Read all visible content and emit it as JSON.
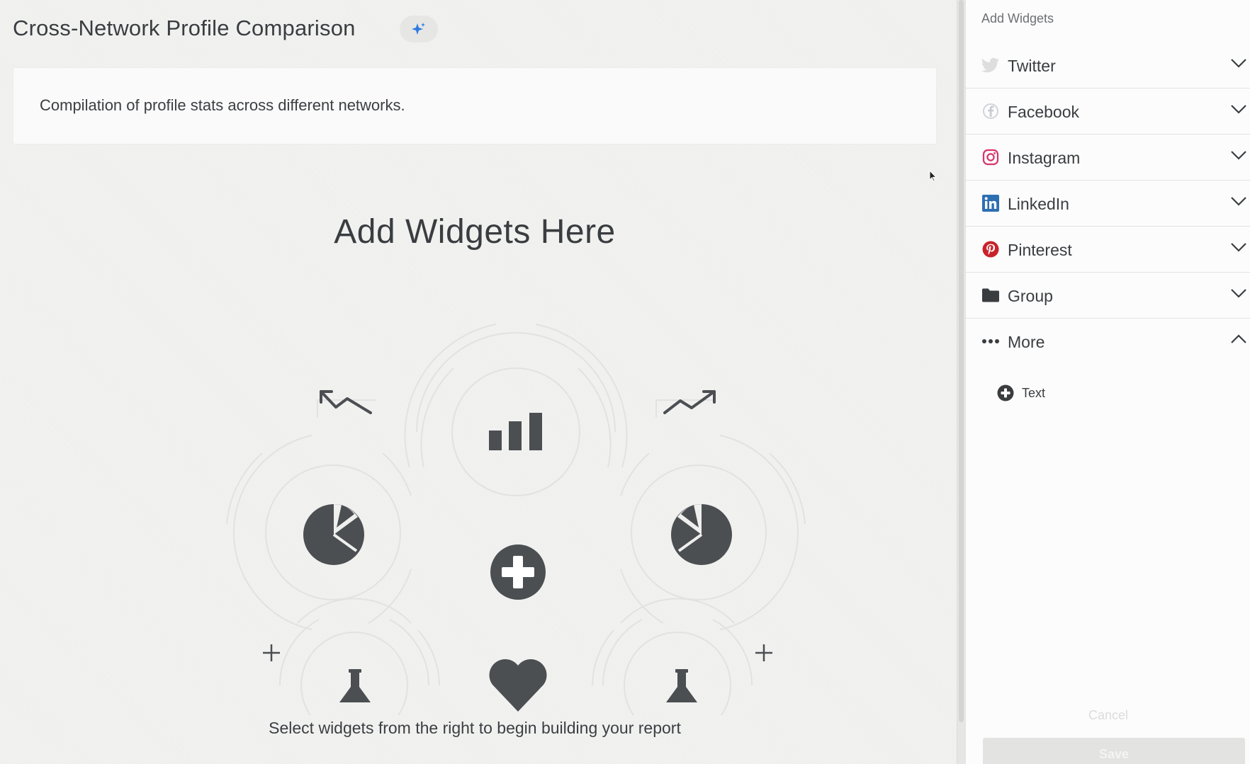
{
  "report": {
    "title": "Cross-Network Profile Comparison",
    "description": "Compilation of profile stats across different networks."
  },
  "empty_state": {
    "title": "Add Widgets Here",
    "subtitle": "Select widgets from the right to begin building your report",
    "icons": [
      "trend-down-icon",
      "bar-chart-icon",
      "trend-up-icon",
      "pie-chart-icon",
      "add-icon",
      "pie-chart-icon",
      "plus-icon",
      "flask-icon",
      "heart-icon",
      "flask-icon",
      "plus-icon"
    ]
  },
  "panel": {
    "heading": "Add Widgets",
    "items": [
      {
        "label": "Twitter",
        "icon": "twitter-icon",
        "expanded": false
      },
      {
        "label": "Facebook",
        "icon": "facebook-icon",
        "expanded": false
      },
      {
        "label": "Instagram",
        "icon": "instagram-icon",
        "expanded": false
      },
      {
        "label": "LinkedIn",
        "icon": "linkedin-icon",
        "expanded": false
      },
      {
        "label": "Pinterest",
        "icon": "pinterest-icon",
        "expanded": false
      },
      {
        "label": "Group",
        "icon": "folder-icon",
        "expanded": false
      },
      {
        "label": "More",
        "icon": "more-icon",
        "expanded": true
      }
    ],
    "more_items": [
      {
        "label": "Text",
        "icon": "add-circle-icon"
      }
    ],
    "cancel_label": "Cancel",
    "save_label": "Save"
  },
  "colors": {
    "icon_dark": "#4b4f52",
    "instagram": "#d8336a",
    "linkedin": "#2e6fb2",
    "pinterest": "#c8232c",
    "sparkle": "#2d7be0"
  }
}
